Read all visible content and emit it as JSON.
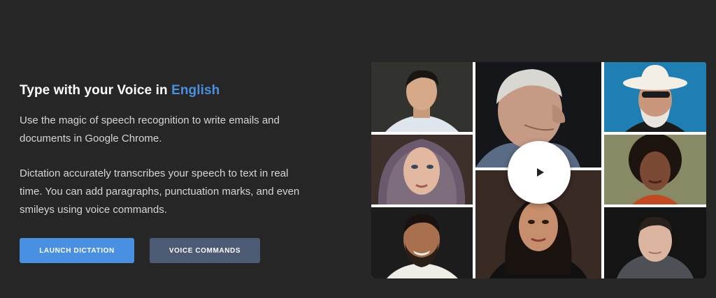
{
  "hero": {
    "title_prefix": "Type with your Voice in ",
    "title_language": "English",
    "paragraph1": "Use the magic of speech recognition to write emails and documents in Google Chrome.",
    "paragraph2": "Dictation accurately transcribes your speech to text in real time. You can add paragraphs, punctuation marks, and even smileys using voice commands."
  },
  "buttons": {
    "launch_label": "LAUNCH DICTATION",
    "voice_commands_label": "VOICE COMMANDS"
  },
  "video": {
    "play_icon": "play-icon",
    "portraits": [
      "portrait-young-asian-man",
      "portrait-woman-headscarf",
      "portrait-bearded-smiling-man",
      "portrait-elderly-man-profile",
      "portrait-woman-dark-hair",
      "portrait-older-man-cowboy-hat",
      "portrait-woman-curly-hair",
      "portrait-man-hoodie"
    ]
  },
  "colors": {
    "background": "#262626",
    "accent": "#4a90e2",
    "secondary_button": "#4d5a74"
  }
}
